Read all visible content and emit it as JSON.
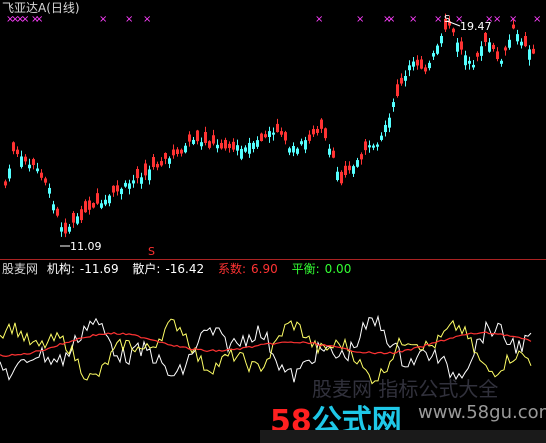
{
  "title": {
    "stock_name": "飞亚达A",
    "period": "(日线)"
  },
  "price_chart": {
    "high_label": "19.47",
    "low_label": "11.09",
    "signal_glyph": "S",
    "signal_color": "#ff3030",
    "mark_glyph": "×",
    "mark_color": "#ff40ff",
    "up_color": "#ff3333",
    "down_color": "#55ffff"
  },
  "indicator": {
    "name": "股麦网",
    "inst_label": "机构:",
    "inst_value": "-11.69",
    "retail_label": "散户:",
    "retail_value": "-16.42",
    "coef_label": "系数:",
    "coef_value": "6.90",
    "balance_label": "平衡:",
    "balance_value": "0.00",
    "colors": {
      "inst": "#ffffff",
      "retail": "#ffff66",
      "coef": "#ff3333",
      "balance": "#33ff33"
    }
  },
  "watermark": {
    "faint_text": "股麦网 指标公式大全",
    "brand_number": "58",
    "brand_text": "公式网",
    "url": "www.58gu.com",
    "brand_number_color": "#ff2020",
    "brand_text_color": "#1ec8e8"
  }
}
